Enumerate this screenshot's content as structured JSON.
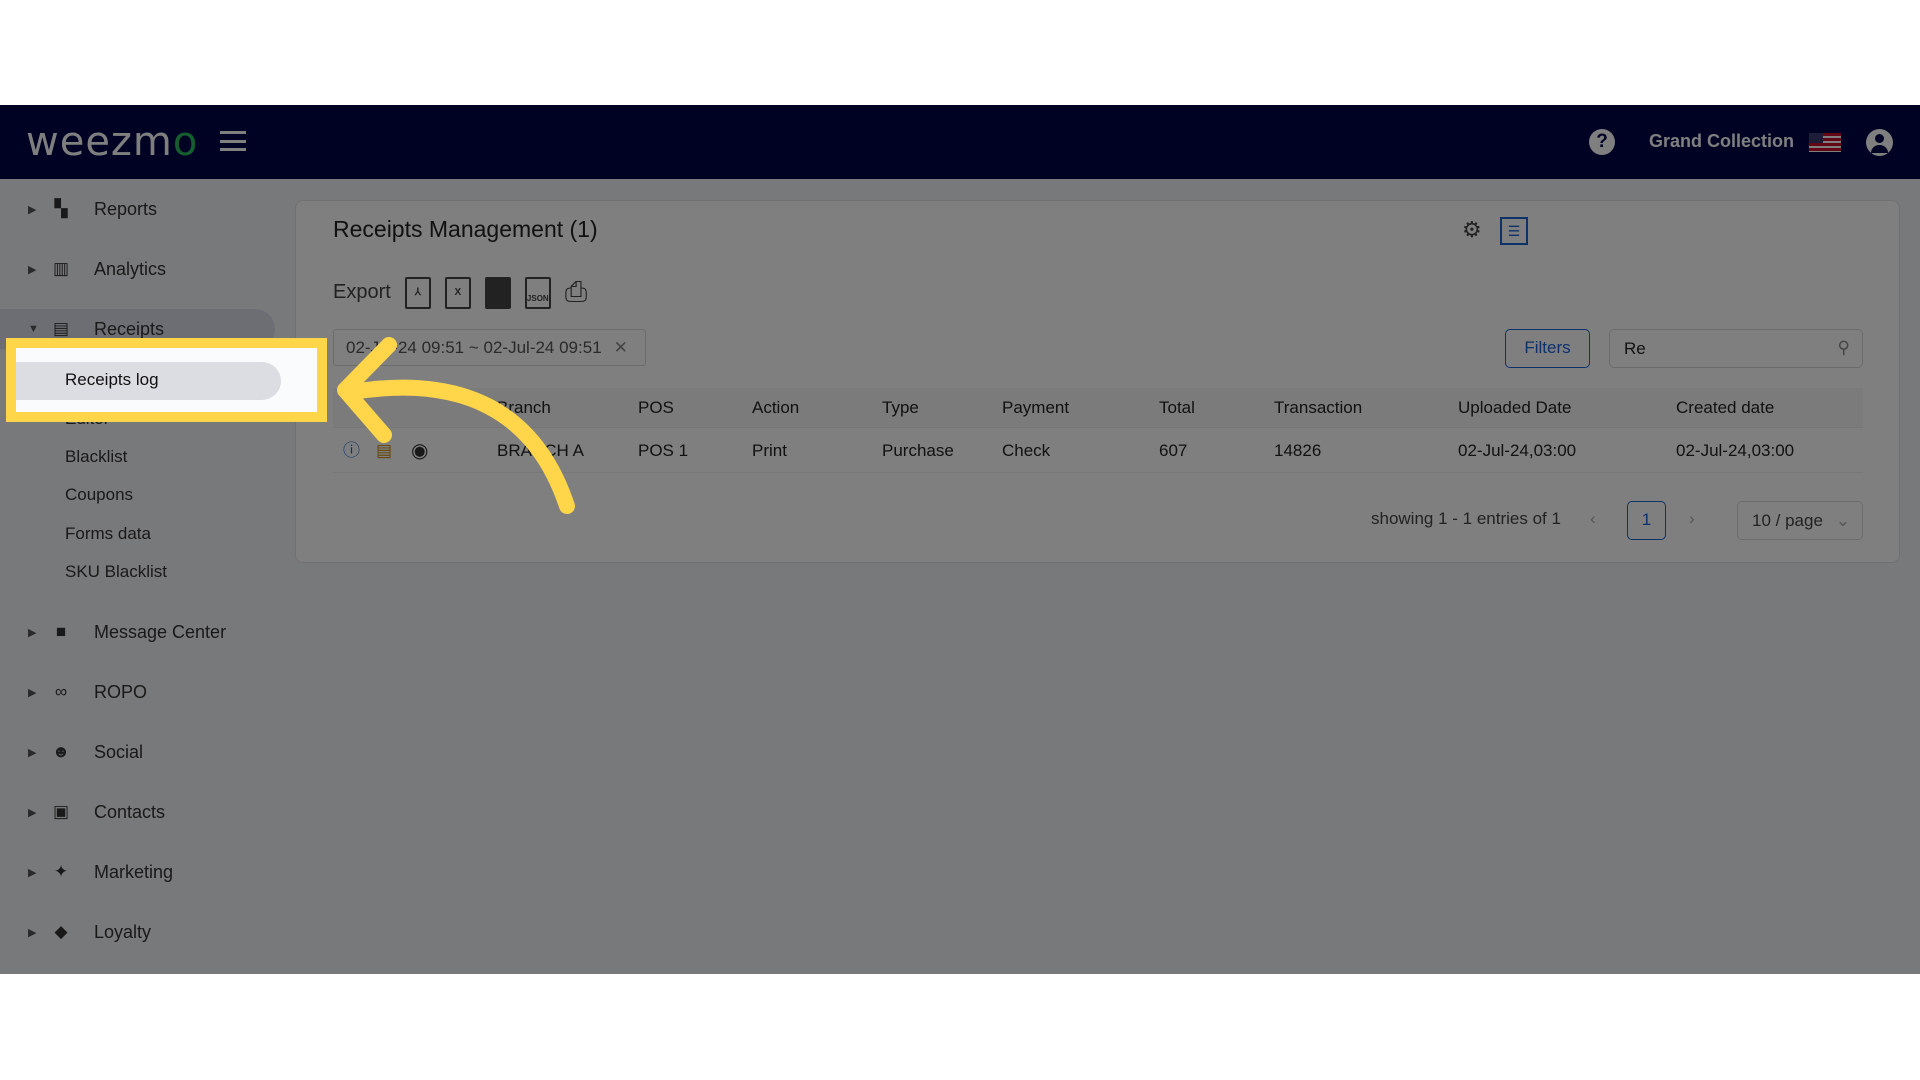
{
  "header": {
    "logo": "weezmo",
    "org_name": "Grand Collection",
    "icons": [
      "menu-icon",
      "help-icon",
      "us-flag-icon",
      "user-icon"
    ]
  },
  "sidebar": {
    "items": [
      {
        "label": "Reports",
        "icon": "dashboard-icon"
      },
      {
        "label": "Analytics",
        "icon": "bar-chart-icon"
      },
      {
        "label": "Receipts",
        "icon": "receipt-icon",
        "expanded": true
      },
      {
        "label": "Message Center",
        "icon": "chat-icon"
      },
      {
        "label": "ROPO",
        "icon": "infinity-icon"
      },
      {
        "label": "Social",
        "icon": "people-icon"
      },
      {
        "label": "Contacts",
        "icon": "contacts-icon"
      },
      {
        "label": "Marketing",
        "icon": "megaphone-icon"
      },
      {
        "label": "Loyalty",
        "icon": "tag-icon"
      }
    ],
    "receipts_sub": [
      "Receipts log",
      "Editor",
      "Blacklist",
      "Coupons",
      "Forms data",
      "SKU Blacklist"
    ]
  },
  "main": {
    "title": "Receipts Management (1)",
    "export_label": "Export",
    "export_formats": [
      "PDF",
      "X",
      "",
      "JSON",
      "print"
    ],
    "date_range": "02-Jul-24 09:51 ~ 02-Jul-24 09:51",
    "filters_label": "Filters",
    "search_value": "Re",
    "columns": [
      "Branch",
      "POS",
      "Action",
      "Type",
      "Payment",
      "Total",
      "Transaction",
      "Uploaded Date",
      "Created date"
    ],
    "rows": [
      [
        "BRANCH A",
        "POS 1",
        "Print",
        "Purchase",
        "Check",
        "607",
        "14826",
        "02-Jul-24,03:00",
        "02-Jul-24,03:00"
      ]
    ],
    "pagination": {
      "summary": "showing 1 - 1 entries of 1",
      "page": "1",
      "page_size": "10 / page"
    }
  },
  "annotation": {
    "highlight_color": "#ffd54a",
    "highlighted_item": "Receipts log"
  }
}
